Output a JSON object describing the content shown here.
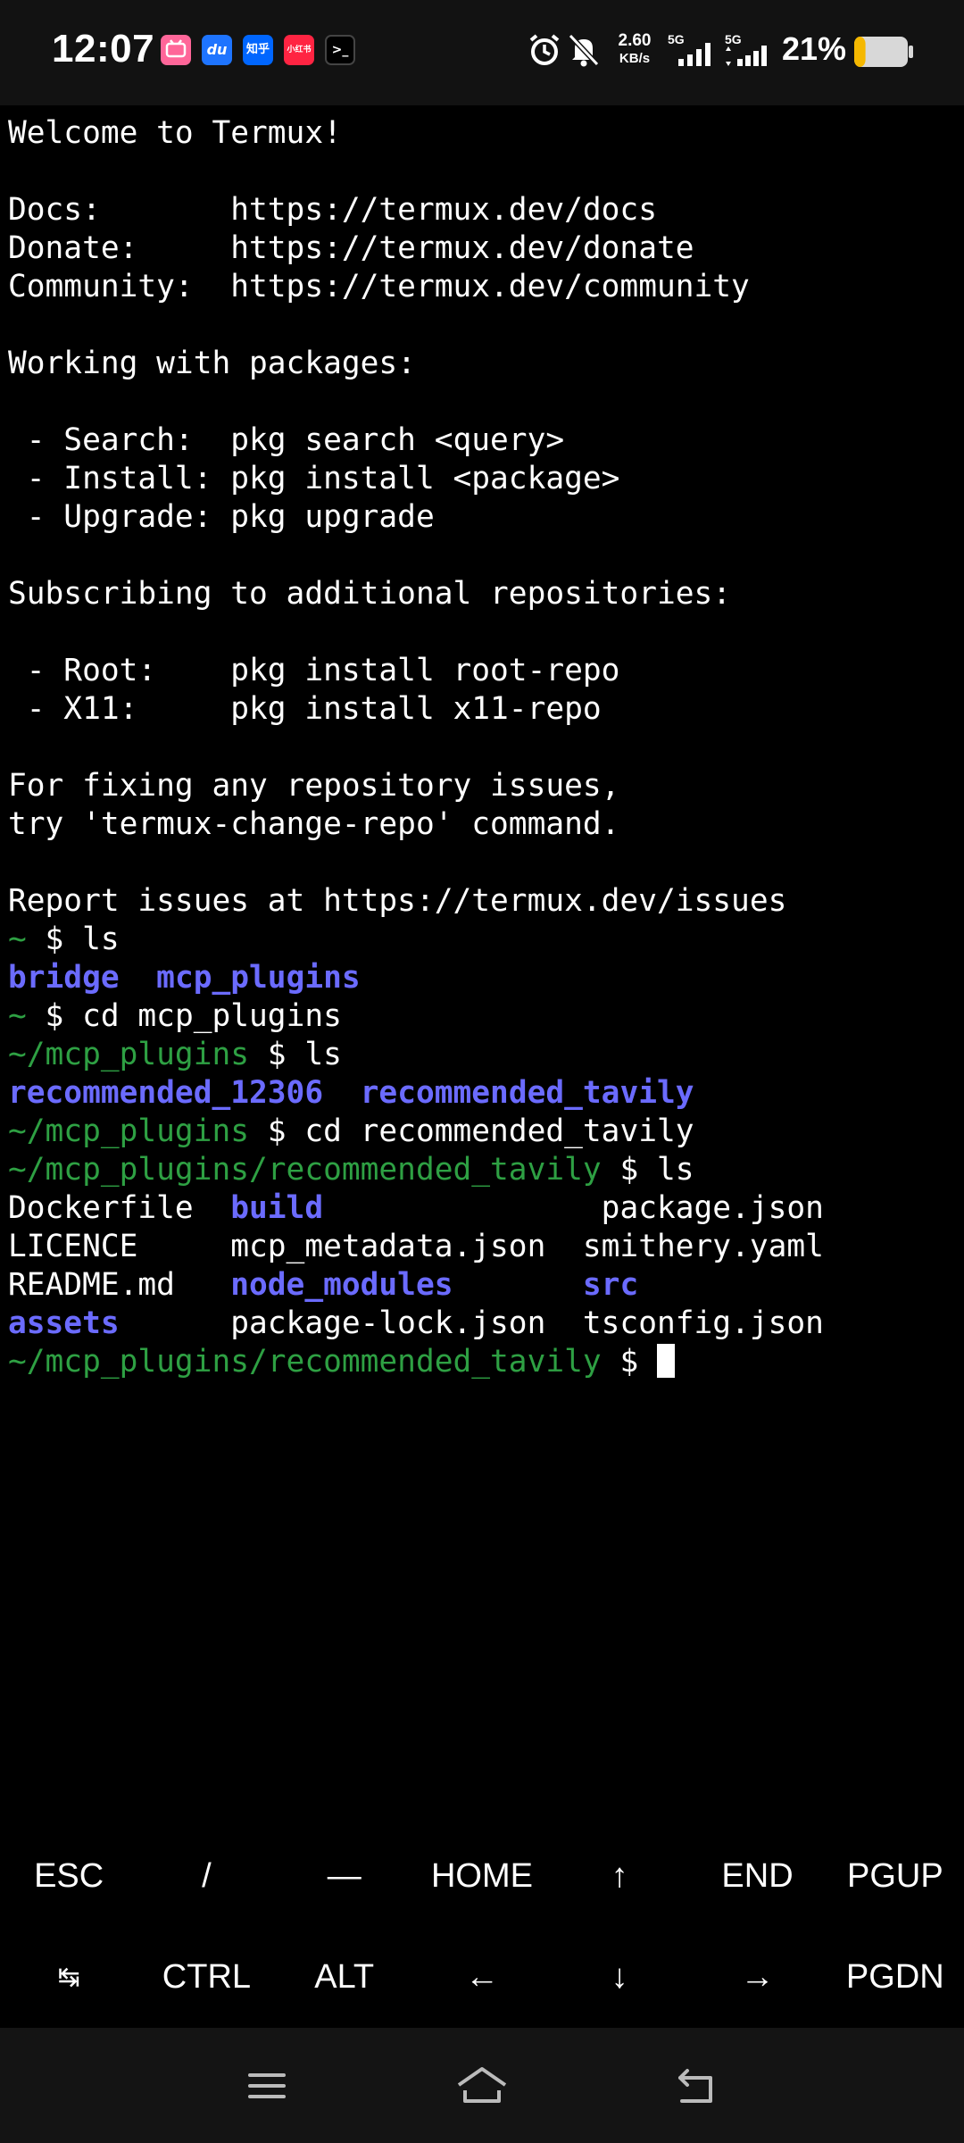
{
  "status_bar": {
    "time": "12:07",
    "apps": [
      {
        "icon": "bilibili-app-icon",
        "color": "#ff6699",
        "text": ""
      },
      {
        "icon": "du-app-icon",
        "color": "#1e74ff",
        "text": "du"
      },
      {
        "icon": "zhihu-app-icon",
        "color": "#0066ff",
        "text": "知乎"
      },
      {
        "icon": "xiaohongshu-app-icon",
        "color": "#ff2442",
        "text": "小红书"
      },
      {
        "icon": "termux-app-icon",
        "color": "#000000",
        "text": ">_"
      }
    ],
    "net_speed_value": "2.60",
    "net_speed_unit": "KB/s",
    "sim1_label": "5G",
    "sim2_label": "5G",
    "battery_percent": "21%",
    "battery_level": 0.21,
    "battery_color": "#f5b800"
  },
  "terminal": {
    "lines": [
      [
        {
          "t": "Welcome to Termux!"
        }
      ],
      [],
      [
        {
          "t": "Docs:       https://termux.dev/docs"
        }
      ],
      [
        {
          "t": "Donate:     https://termux.dev/donate"
        }
      ],
      [
        {
          "t": "Community:  https://termux.dev/community"
        }
      ],
      [],
      [
        {
          "t": "Working with packages:"
        }
      ],
      [],
      [
        {
          "t": " - Search:  pkg search <query>"
        }
      ],
      [
        {
          "t": " - Install: pkg install <package>"
        }
      ],
      [
        {
          "t": " - Upgrade: pkg upgrade"
        }
      ],
      [],
      [
        {
          "t": "Subscribing to additional repositories:"
        }
      ],
      [],
      [
        {
          "t": " - Root:    pkg install root-repo"
        }
      ],
      [
        {
          "t": " - X11:     pkg install x11-repo"
        }
      ],
      [],
      [
        {
          "t": "For fixing any repository issues,"
        }
      ],
      [
        {
          "t": "try 'termux-change-repo' command."
        }
      ],
      [],
      [
        {
          "t": "Report issues at https://termux.dev/issues"
        }
      ],
      [
        {
          "t": "~",
          "c": "prompt"
        },
        {
          "t": " $ ls"
        }
      ],
      [
        {
          "t": "bridge",
          "c": "dir"
        },
        {
          "t": "  "
        },
        {
          "t": "mcp_plugins",
          "c": "dir"
        }
      ],
      [
        {
          "t": "~",
          "c": "prompt"
        },
        {
          "t": " $ cd mcp_plugins"
        }
      ],
      [
        {
          "t": "~/mcp_plugins",
          "c": "prompt"
        },
        {
          "t": " $ ls"
        }
      ],
      [
        {
          "t": "recommended_12306",
          "c": "dir"
        },
        {
          "t": "  "
        },
        {
          "t": "recommended_tavily",
          "c": "dir"
        }
      ],
      [
        {
          "t": "~/mcp_plugins",
          "c": "prompt"
        },
        {
          "t": " $ cd recommended_tavily"
        }
      ],
      [
        {
          "t": "~/mcp_plugins/recommended_tavily",
          "c": "prompt"
        },
        {
          "t": " $ ls"
        }
      ],
      [
        {
          "t": "Dockerfile  "
        },
        {
          "t": "build",
          "c": "dir"
        },
        {
          "t": "               package.json"
        }
      ],
      [
        {
          "t": "LICENCE     mcp_metadata.json  smithery.yaml"
        }
      ],
      [
        {
          "t": "README.md   "
        },
        {
          "t": "node_modules",
          "c": "dir"
        },
        {
          "t": "       "
        },
        {
          "t": "src",
          "c": "dir"
        }
      ],
      [
        {
          "t": "assets",
          "c": "dir"
        },
        {
          "t": "      package-lock.json  tsconfig.json"
        }
      ],
      [
        {
          "t": "~/mcp_plugins/recommended_tavily",
          "c": "prompt"
        },
        {
          "t": " $ "
        },
        {
          "cursor": true
        }
      ]
    ]
  },
  "extra_keys": {
    "row1": [
      {
        "label": "ESC",
        "name": "esc-key"
      },
      {
        "label": "/",
        "name": "slash-key"
      },
      {
        "label": "—",
        "name": "dash-key"
      },
      {
        "label": "HOME",
        "name": "home-key"
      },
      {
        "label": "↑",
        "name": "up-arrow-key"
      },
      {
        "label": "END",
        "name": "end-key"
      },
      {
        "label": "PGUP",
        "name": "pgup-key"
      }
    ],
    "row2": [
      {
        "label": "↹",
        "name": "tab-key"
      },
      {
        "label": "CTRL",
        "name": "ctrl-key"
      },
      {
        "label": "ALT",
        "name": "alt-key"
      },
      {
        "label": "←",
        "name": "left-arrow-key"
      },
      {
        "label": "↓",
        "name": "down-arrow-key"
      },
      {
        "label": "→",
        "name": "right-arrow-key"
      },
      {
        "label": "PGDN",
        "name": "pgdn-key"
      }
    ]
  },
  "nav_bar": {
    "buttons": [
      "menu-icon",
      "home-icon",
      "back-icon"
    ]
  }
}
